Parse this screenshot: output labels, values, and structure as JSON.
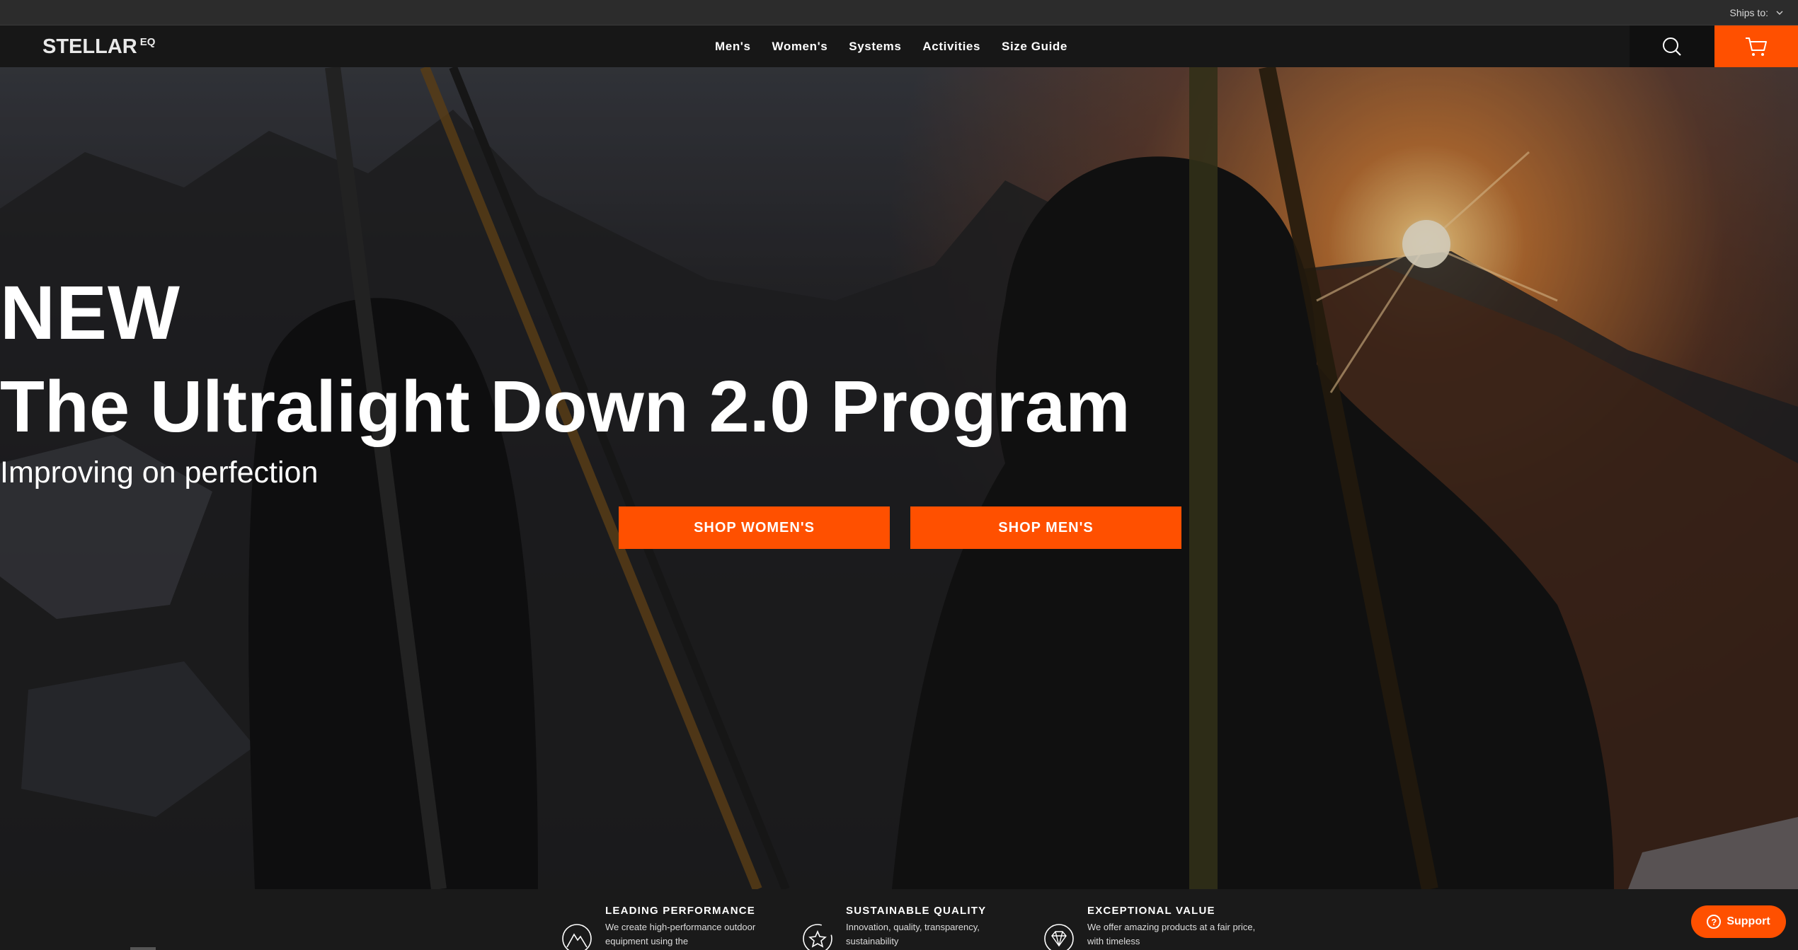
{
  "topbar": {
    "ships_to_label": "Ships to:"
  },
  "nav": {
    "logo_text": "STELLAR",
    "logo_sup": "EQ",
    "menu": [
      "Men's",
      "Women's",
      "Systems",
      "Activities",
      "Size Guide"
    ]
  },
  "hero": {
    "eyebrow": "NEW",
    "headline": "The Ultralight Down 2.0 Program",
    "subhead": "Improving on perfection",
    "cta_women": "SHOP WOMEN'S",
    "cta_men": "SHOP MEN'S"
  },
  "features": [
    {
      "title": "LEADING PERFORMANCE",
      "desc": "We create high-performance outdoor equipment using the",
      "icon": "mountain-icon"
    },
    {
      "title": "SUSTAINABLE QUALITY",
      "desc": "Innovation, quality, transparency, sustainability",
      "icon": "star-badge-icon"
    },
    {
      "title": "EXCEPTIONAL VALUE",
      "desc": "We offer amazing products at a fair price, with timeless",
      "icon": "diamond-icon"
    }
  ],
  "support": {
    "label": "Support"
  },
  "colors": {
    "accent": "#ff5000",
    "nav_bg": "#171717",
    "topbar_bg": "#2c2c2c"
  }
}
